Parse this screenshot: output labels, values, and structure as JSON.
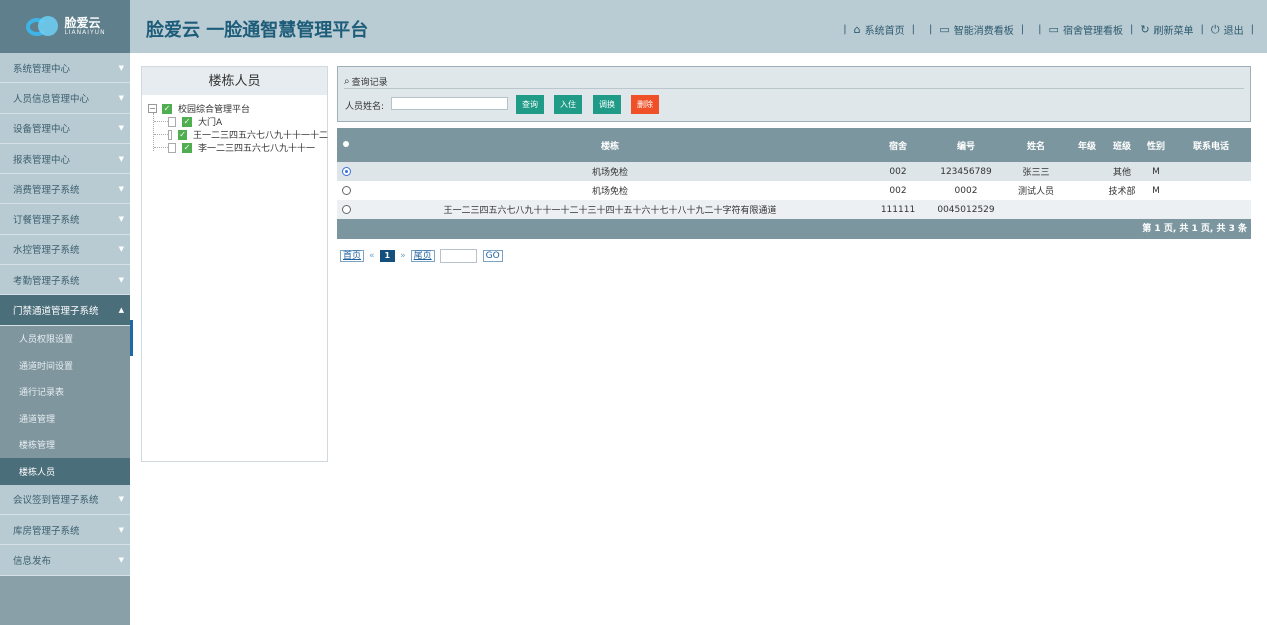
{
  "brand": {
    "logo_cn": "脸爱云",
    "logo_en": "LIANAIYUN",
    "title": "脸爱云 一脸通智慧管理平台"
  },
  "topnav": [
    {
      "icon": "home-icon",
      "label": "系统首页"
    },
    {
      "icon": "monitor-icon",
      "label": "智能消费看板"
    },
    {
      "icon": "monitor-icon",
      "label": "宿舍管理看板"
    },
    {
      "icon": "refresh-icon",
      "label": "刷新菜单"
    },
    {
      "icon": "power-icon",
      "label": "退出"
    }
  ],
  "sidebar": {
    "menus_top": [
      "系统管理中心",
      "人员信息管理中心",
      "设备管理中心",
      "报表管理中心",
      "消费管理子系统",
      "订餐管理子系统",
      "水控管理子系统",
      "考勤管理子系统"
    ],
    "active_menu": "门禁通道管理子系统",
    "sub_items": [
      "人员权限设置",
      "通道时间设置",
      "通行记录表",
      "通道管理",
      "楼栋管理"
    ],
    "current_item": "楼栋人员",
    "menus_bottom": [
      "会议签到管理子系统",
      "库房管理子系统",
      "信息发布"
    ]
  },
  "tree": {
    "title": "楼栋人员",
    "root": "校园综合管理平台",
    "children": [
      "大门A",
      "王一二三四五六七八九十十一十二",
      "李一二三四五六七八九十十一"
    ]
  },
  "query": {
    "title": "查询记录",
    "name_label": "人员姓名:",
    "name_value": "",
    "buttons": {
      "search": "查询",
      "checkin": "入住",
      "transfer": "调换",
      "delete": "删除"
    }
  },
  "table": {
    "headers": [
      "楼栋",
      "宿舍",
      "编号",
      "姓名",
      "年级",
      "班级",
      "性别",
      "联系电话"
    ],
    "rows": [
      {
        "selected": true,
        "building": "机场免检",
        "dorm": "002",
        "code": "123456789",
        "name": "张三三",
        "grade": "",
        "class": "其他",
        "gender": "M",
        "phone": ""
      },
      {
        "selected": false,
        "building": "机场免检",
        "dorm": "002",
        "code": "0002",
        "name": "测试人员",
        "grade": "",
        "class": "技术部",
        "gender": "M",
        "phone": ""
      },
      {
        "selected": false,
        "building": "王一二三四五六七八九十十一十二十三十四十五十六十七十八十九二十字符有限通道",
        "dorm": "111111",
        "code": "0045012529",
        "name": "",
        "grade": "",
        "class": "",
        "gender": "",
        "phone": ""
      }
    ],
    "footer": "第 1 页, 共 1 页, 共 3 条"
  },
  "pager": {
    "first": "首页",
    "prev": "«",
    "current": "1",
    "next": "»",
    "last": "尾页",
    "go": "GO"
  }
}
